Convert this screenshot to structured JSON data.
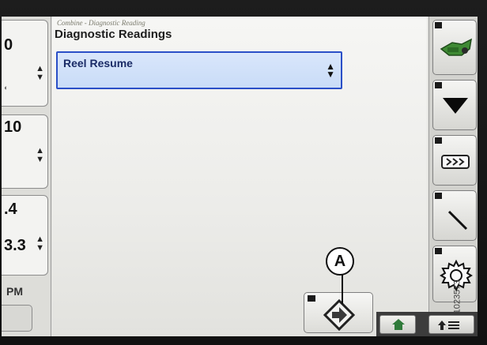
{
  "header": {
    "breadcrumb": "Combine - Diagnostic Reading",
    "title": "Diagnostic Readings"
  },
  "dropdown": {
    "selected": "Reel Resume"
  },
  "left_panel": {
    "boxes": [
      {
        "value": "0"
      },
      {
        "value": "10"
      },
      {
        "value": ".4",
        "value2": "3.3"
      }
    ],
    "footer_label": "PM"
  },
  "callout": {
    "label": "A"
  },
  "figure_id": "1023573",
  "colors": {
    "dropdown_fill": "#c9dcf7",
    "dropdown_border": "#2a4fc7",
    "header_bar_icon": "#3f8a34",
    "home_icon": "#2f7a3a"
  },
  "icons": {
    "right_toolbar": [
      "combine-header-icon",
      "down-arrow-icon",
      "conveyor-icon",
      "wrench-icon",
      "gear-icon"
    ],
    "confirm": "confirm-arrow-icon",
    "home": "home-icon",
    "up_menu": "up-menu-icon"
  }
}
